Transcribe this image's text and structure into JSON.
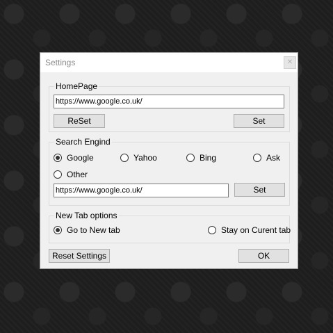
{
  "dialog": {
    "title": "Settings",
    "close_glyph": "✕"
  },
  "homepage": {
    "group_label": "HomePage",
    "url_value": "https://www.google.co.uk/",
    "reset_label": "ReSet",
    "set_label": "Set"
  },
  "search_engine": {
    "group_label": "Search Engind",
    "options": [
      {
        "label": "Google",
        "checked": true
      },
      {
        "label": "Yahoo",
        "checked": false
      },
      {
        "label": "Bing",
        "checked": false
      },
      {
        "label": "Ask",
        "checked": false
      },
      {
        "label": "Other",
        "checked": false
      }
    ],
    "url_value": "https://www.google.co.uk/",
    "set_label": "Set"
  },
  "new_tab": {
    "group_label": "New Tab options",
    "options": [
      {
        "label": "Go to New tab",
        "checked": true
      },
      {
        "label": "Stay on Curent tab",
        "checked": false
      }
    ]
  },
  "footer": {
    "reset_settings_label": "Reset Settings",
    "ok_label": "OK"
  },
  "colors": {
    "dialog_bg": "#f0f0f0",
    "desktop_bg": "#1e1e1e"
  },
  "icons": {
    "close": "close-icon",
    "radio": "radio-icon"
  }
}
